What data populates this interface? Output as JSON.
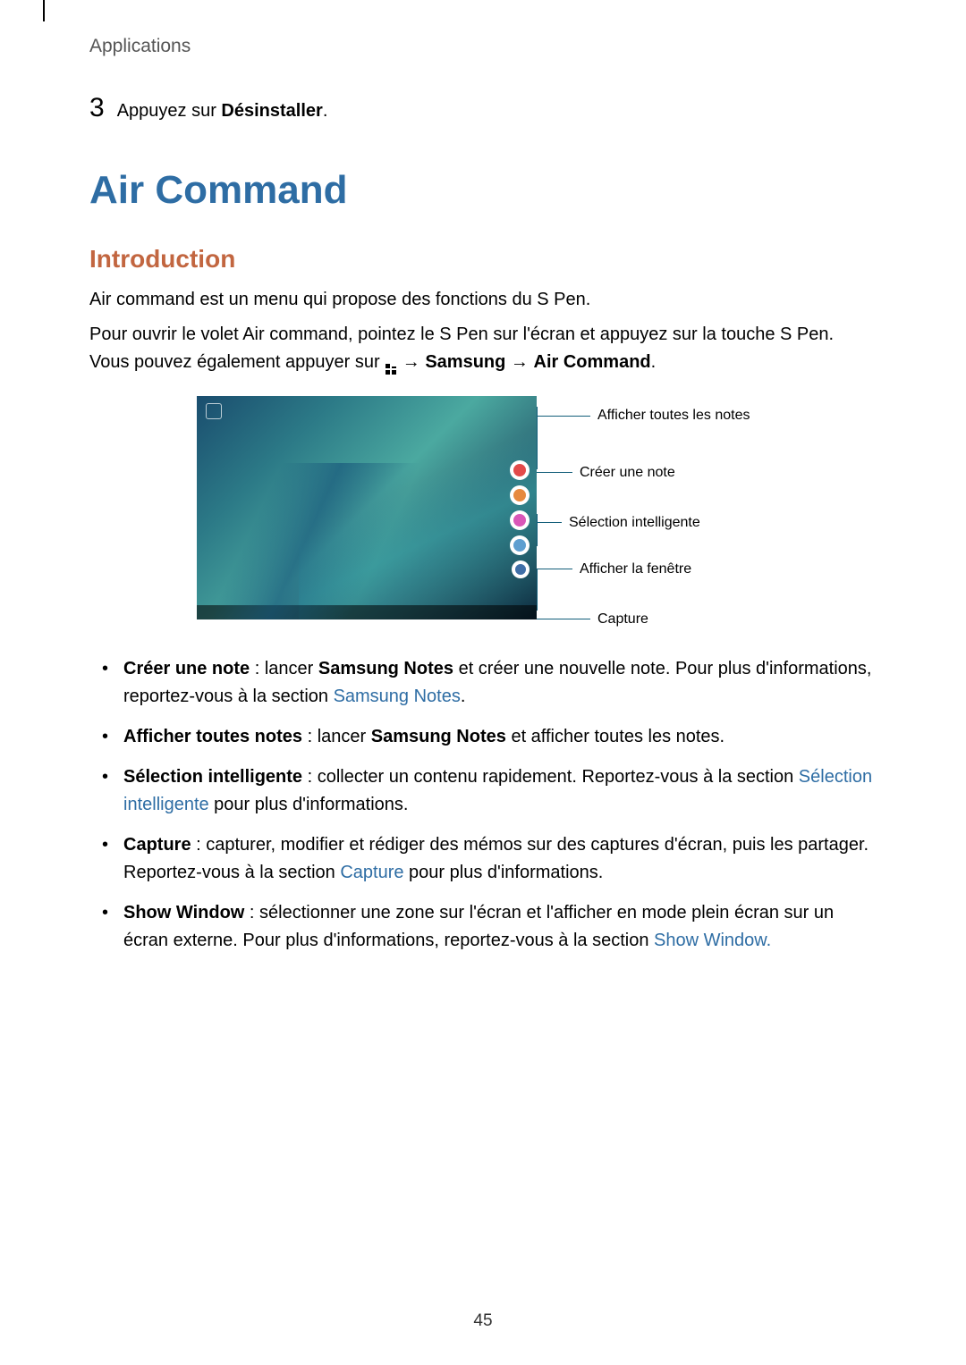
{
  "header": "Applications",
  "step": {
    "num": "3",
    "prefix": "Appuyez sur ",
    "bold": "Désinstaller",
    "suffix": "."
  },
  "h1": "Air Command",
  "h2": "Introduction",
  "intro_p1": "Air command est un menu qui propose des fonctions du S Pen.",
  "intro_p2_a": "Pour ouvrir le volet Air command, pointez le S Pen sur l'écran et appuyez sur la touche S Pen. Vous pouvez également appuyer sur ",
  "intro_p2_arrow1": " → ",
  "intro_p2_b": "Samsung",
  "intro_p2_arrow2": " → ",
  "intro_p2_c": "Air Command",
  "intro_p2_d": ".",
  "callouts": {
    "c1": "Afficher toutes les notes",
    "c2": "Créer une note",
    "c3": "Sélection intelligente",
    "c4": "Afficher la fenêtre",
    "c5": "Capture"
  },
  "bullets": {
    "b1": {
      "bold": "Créer une note",
      "t1": " : lancer ",
      "bold2": "Samsung Notes",
      "t2": " et créer une nouvelle note. Pour plus d'informations, reportez-vous à la section ",
      "link": "Samsung Notes",
      "t3": "."
    },
    "b2": {
      "bold": "Afficher toutes notes",
      "t1": " : lancer ",
      "bold2": "Samsung Notes",
      "t2": " et afficher toutes les notes."
    },
    "b3": {
      "bold": "Sélection intelligente",
      "t1": " : collecter un contenu rapidement. Reportez-vous à la section ",
      "link": "Sélection intelligente",
      "t2": " pour plus d'informations."
    },
    "b4": {
      "bold": "Capture",
      "t1": " : capturer, modifier et rédiger des mémos sur des captures d'écran, puis les partager. Reportez-vous à la section ",
      "link": "Capture",
      "t2": " pour plus d'informations."
    },
    "b5": {
      "bold": "Show Window",
      "t1": " : sélectionner une zone sur l'écran et l'afficher en mode plein écran sur un écran externe. Pour plus d'informations, reportez-vous à la section ",
      "link": "Show Window.",
      "t2": ""
    }
  },
  "page_num": "45"
}
